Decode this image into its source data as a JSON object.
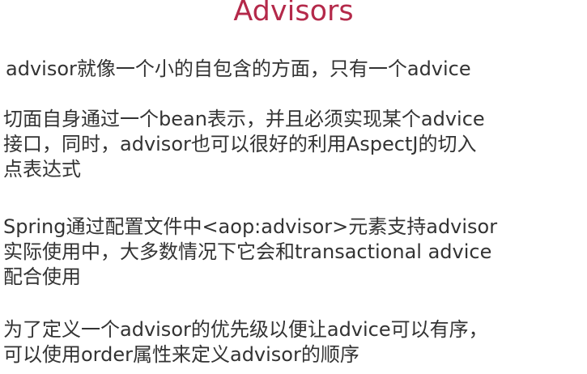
{
  "slide": {
    "title": "Advisors",
    "colors": {
      "title": "#b4294a",
      "text": "#333333"
    },
    "paragraphs": [
      {
        "lines": [
          "advisor就像一个小的自包含的方面，只有一个advice"
        ]
      },
      {
        "lines": [
          "切面自身通过一个bean表示，并且必须实现某个advice",
          "接口，同时，advisor也可以很好的利用AspectJ的切入",
          "点表达式"
        ]
      },
      {
        "lines": [
          "Spring通过配置文件中<aop:advisor>元素支持advisor",
          "实际使用中，大多数情况下它会和transactional advice",
          "配合使用"
        ]
      },
      {
        "lines": [
          "为了定义一个advisor的优先级以便让advice可以有序，",
          "可以使用order属性来定义advisor的顺序"
        ]
      }
    ]
  }
}
